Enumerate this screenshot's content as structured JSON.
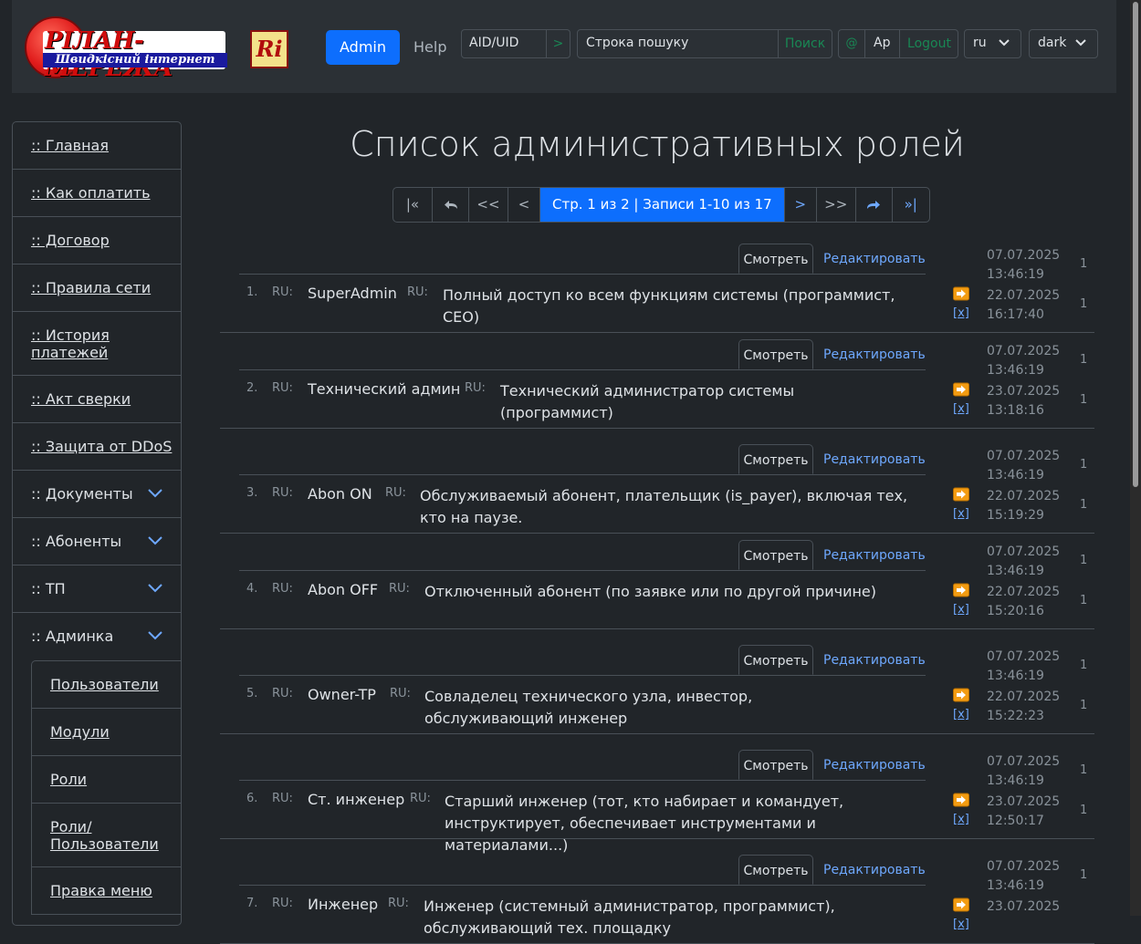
{
  "header": {
    "logo_title": "РІЛАН-МЕРЕЖА",
    "logo_subtitle": "Швидкісний інтернет",
    "ri_logo": "Ri",
    "admin_label": "Admin",
    "help_label": "Help",
    "aid_placeholder": "AID/UID",
    "aid_go": ">",
    "search_placeholder": "Строка пошуку",
    "search_button": "Поиск",
    "at_label": "@",
    "user_name": "Ap",
    "logout_label": "Logout",
    "lang_value": "ru",
    "theme_value": "dark"
  },
  "sidebar": {
    "items": [
      {
        "label": ":: Главная"
      },
      {
        "label": ":: Как оплатить"
      },
      {
        "label": ":: Договор"
      },
      {
        "label": ":: Правила сети"
      },
      {
        "label": ":: История платежей"
      },
      {
        "label": ":: Акт сверки"
      },
      {
        "label": ":: Защита от DDoS"
      },
      {
        "label": ":: Документы"
      },
      {
        "label": ":: Абоненты"
      },
      {
        "label": ":: ТП"
      },
      {
        "label": ":: Админка"
      }
    ],
    "subitems": [
      {
        "label": "Пользователи"
      },
      {
        "label": "Модули"
      },
      {
        "label": "Роли"
      },
      {
        "label": "Роли/ Пользователи"
      },
      {
        "label": "Правка меню"
      }
    ]
  },
  "main": {
    "title": "Список административных ролей",
    "pager": {
      "first": "|«",
      "back": "➦",
      "prev_many": "<<",
      "prev": "<",
      "status": "Стр. 1 из 2 | Записи 1-10 из 17",
      "next": ">",
      "next_many": ">>",
      "forward": "➦",
      "last": "»|"
    },
    "view_label": "Смотреть",
    "edit_label": "Редактировать",
    "ru_label": "RU:",
    "delete_label": "[x]",
    "rows": [
      {
        "num": "1.",
        "name": "SuperAdmin",
        "desc": "Полный доступ ко всем функциям системы (программист, CEO)",
        "created_date": "07.07.2025",
        "created_time": "13:46:19",
        "updated_date": "22.07.2025",
        "updated_time": "16:17:40",
        "c1": "1",
        "c2": "1"
      },
      {
        "num": "2.",
        "name": "Технический админ",
        "desc": "Технический администратор системы (программист)",
        "created_date": "07.07.2025",
        "created_time": "13:46:19",
        "updated_date": "23.07.2025",
        "updated_time": "13:18:16",
        "c1": "1",
        "c2": "1"
      },
      {
        "num": "3.",
        "name": "Abon ON",
        "desc": "Обслуживаемый абонент, плательщик (is_payer), включая тех, кто на паузе.",
        "created_date": "07.07.2025",
        "created_time": "13:46:19",
        "updated_date": "22.07.2025",
        "updated_time": "15:19:29",
        "c1": "1",
        "c2": "1"
      },
      {
        "num": "4.",
        "name": "Abon OFF",
        "desc": "Отключенный абонент (по заявке или по другой причине)",
        "created_date": "07.07.2025",
        "created_time": "13:46:19",
        "updated_date": "22.07.2025",
        "updated_time": "15:20:16",
        "c1": "1",
        "c2": "1"
      },
      {
        "num": "5.",
        "name": "Owner-TP",
        "desc": "Совладелец технического узла, инвестор, обслуживающий инженер",
        "created_date": "07.07.2025",
        "created_time": "13:46:19",
        "updated_date": "22.07.2025",
        "updated_time": "15:22:23",
        "c1": "1",
        "c2": "1"
      },
      {
        "num": "6.",
        "name": "Ст. инженер",
        "desc": "Старший инженер (тот, кто набирает и командует, инструктирует, обеспечивает инструментами и материалами...)",
        "created_date": "07.07.2025",
        "created_time": "13:46:19",
        "updated_date": "23.07.2025",
        "updated_time": "12:50:17",
        "c1": "1",
        "c2": "1"
      },
      {
        "num": "7.",
        "name": "Инженер",
        "desc": "Инженер (системный администратор, программист), обслуживающий тех. площадку",
        "created_date": "07.07.2025",
        "created_time": "13:46:19",
        "updated_date": "23.07.2025",
        "updated_time": "",
        "c1": "1",
        "c2": ""
      }
    ]
  }
}
